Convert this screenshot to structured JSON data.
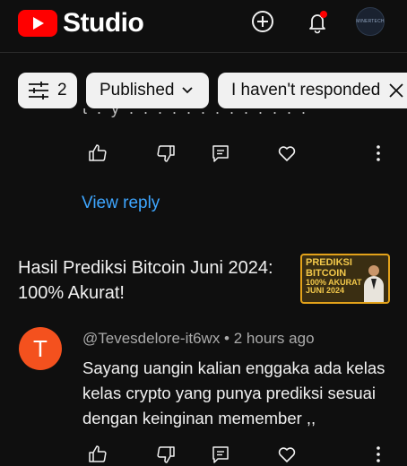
{
  "header": {
    "logo_text": "Studio",
    "avatar_text": "MINERTECH"
  },
  "filters": {
    "filter_count": "2",
    "status_label": "Published",
    "responded_label": "I haven't responded"
  },
  "previous_comment": {
    "truncated_text": "t . y . . . . . . . . . . . . ."
  },
  "view_reply_label": "View reply",
  "video": {
    "title": "Hasil Prediksi Bitcoin Juni 2024: 100% Akurat!",
    "thumbnail_text": [
      "PREDIKSI",
      "BITCOIN",
      "100% AKURAT",
      "JUNI 2024"
    ]
  },
  "comment": {
    "avatar_letter": "T",
    "author": "@Tevesdelore-it6wx",
    "separator": " • ",
    "time": "2 hours ago",
    "text": "Sayang uangin kalian enggaka ada kelas kelas crypto yang punya prediksi sesuai dengan keinginan memember ,,"
  },
  "colors": {
    "background": "#0f0f0f",
    "brand_red": "#ff0000",
    "link_blue": "#3ea6ff",
    "chip_bg": "#f1f1f1",
    "avatar_orange": "#f4511e",
    "notification_dot": "#ff0000"
  },
  "icons": [
    "create-icon",
    "notifications-icon",
    "filter-icon",
    "chevron-down-icon",
    "close-icon",
    "thumbs-up-icon",
    "thumbs-down-icon",
    "reply-icon",
    "heart-icon",
    "more-vert-icon"
  ]
}
